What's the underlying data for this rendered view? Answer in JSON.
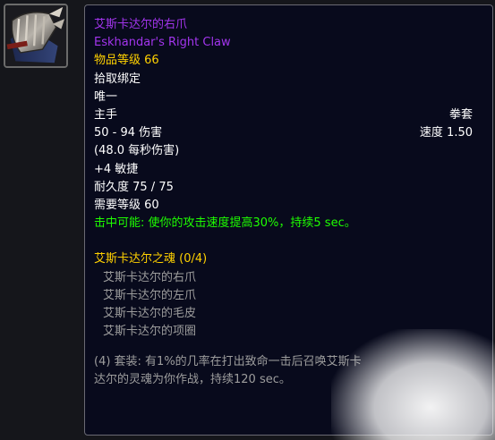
{
  "item": {
    "name_cn": "艾斯卡达尔的右爪",
    "name_en": "Eskhandar's Right Claw",
    "item_level": "物品等级 66",
    "binding": "拾取绑定",
    "unique": "唯一",
    "slot": "主手",
    "weapon_type": "拳套",
    "damage": "50 - 94 伤害",
    "speed": "速度 1.50",
    "dps": "(48.0 每秒伤害)",
    "stat": "+4 敏捷",
    "durability": "耐久度 75 / 75",
    "required_level": "需要等级 60",
    "on_hit": "击中可能: 使你的攻击速度提高30%，持续5 sec。",
    "set": {
      "title": "艾斯卡达尔之魂 (0/4)",
      "pieces": [
        "艾斯卡达尔的右爪",
        "艾斯卡达尔的左爪",
        "艾斯卡达尔的毛皮",
        "艾斯卡达尔的项圈"
      ],
      "bonus": "(4) 套装: 有1%的几率在打出致命一击后召唤艾斯卡达尔的灵魂为你作战，持续120 sec。"
    }
  },
  "icon": {
    "name": "claw-weapon-icon"
  },
  "colors": {
    "epic": "#a335ee",
    "item_level": "#ffd100",
    "on_hit": "#1eff00",
    "set_title": "#ffd100",
    "inactive": "#9d9d9d",
    "tooltip_bg": "#080a1c"
  }
}
